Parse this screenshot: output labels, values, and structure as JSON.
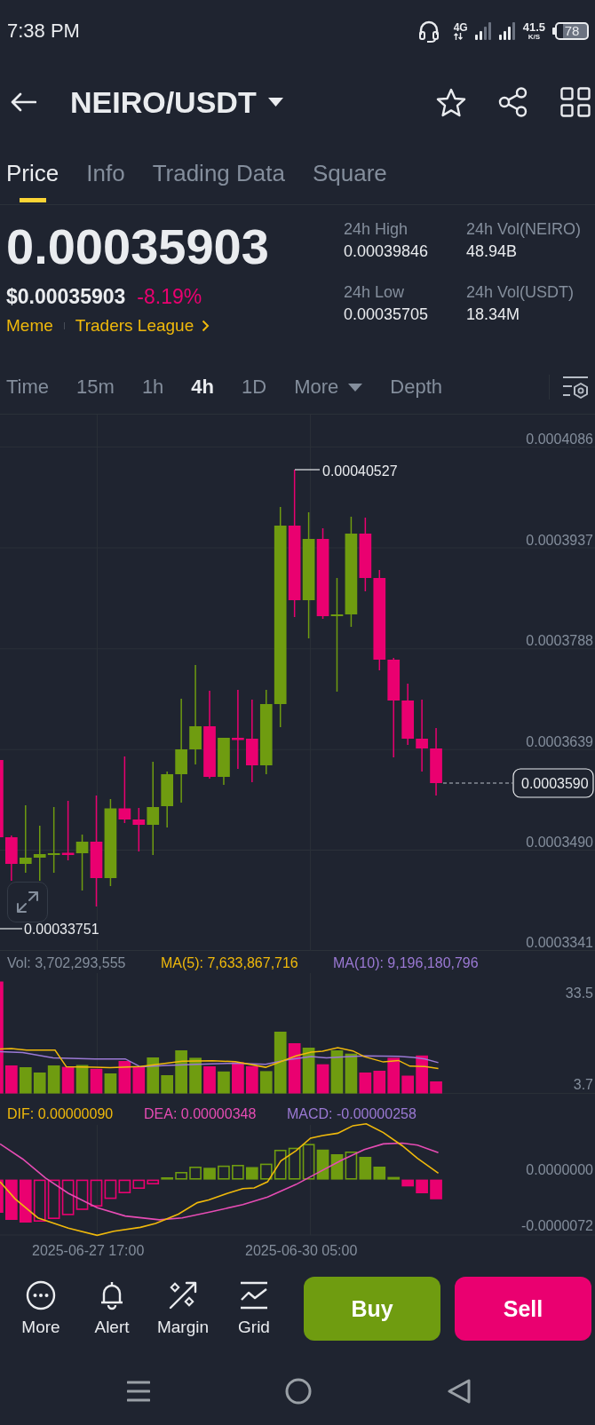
{
  "status_bar": {
    "time": "7:38 PM",
    "network": "4G",
    "speed": "41.5",
    "speed_unit": "K/S",
    "battery": "78"
  },
  "header": {
    "title": "NEIRO/USDT"
  },
  "tabs": [
    {
      "label": "Price",
      "selected": true
    },
    {
      "label": "Info",
      "selected": false
    },
    {
      "label": "Trading Data",
      "selected": false
    },
    {
      "label": "Square",
      "selected": false
    }
  ],
  "ticker": {
    "price": "0.00035903",
    "fiat_price": "$0.00035903",
    "change": "-8.19%",
    "tags": [
      {
        "label": "Meme",
        "kind": "tag"
      },
      {
        "label": "Traders League",
        "kind": "link"
      }
    ]
  },
  "stats": [
    {
      "label": "24h High",
      "value": "0.00039846"
    },
    {
      "label": "24h Vol(NEIRO)",
      "value": "48.94B"
    },
    {
      "label": "24h Low",
      "value": "0.00035705"
    },
    {
      "label": "24h Vol(USDT)",
      "value": "18.34M"
    }
  ],
  "intervals": [
    {
      "label": "Time",
      "kind": "option",
      "selected": false
    },
    {
      "label": "15m",
      "kind": "option",
      "selected": false
    },
    {
      "label": "1h",
      "kind": "option",
      "selected": false
    },
    {
      "label": "4h",
      "kind": "option",
      "selected": true
    },
    {
      "label": "1D",
      "kind": "option",
      "selected": false
    },
    {
      "label": "More",
      "kind": "dropdown",
      "selected": false
    },
    {
      "label": "Depth",
      "kind": "option",
      "selected": false
    }
  ],
  "price_chart": {
    "axis_labels": [
      "0.0004086",
      "0.0003937",
      "0.0003788",
      "0.0003639",
      "0.0003490",
      "0.0003341"
    ],
    "high_label": "0.00040527",
    "low_label": "0.00033751",
    "last_price": "0.0003590"
  },
  "volume": {
    "legend": [
      {
        "text": "Vol: 3,702,293,555",
        "color": "#848e9c"
      },
      {
        "text": "MA(5): 7,633,867,716",
        "color": "#f0b90b"
      },
      {
        "text": "MA(10): 9,196,180,796",
        "color": "#9b79d4"
      }
    ],
    "axis_labels": [
      "33.5",
      "3.7"
    ]
  },
  "macd": {
    "legend": [
      {
        "text": "DIF: 0.00000090",
        "color": "#f0b90b"
      },
      {
        "text": "DEA: 0.00000348",
        "color": "#e64cb4"
      },
      {
        "text": "MACD: -0.00000258",
        "color": "#9b79d4"
      }
    ],
    "axis_labels": [
      "0.0000000",
      "-0.0000072"
    ]
  },
  "time_axis": [
    "2025-06-27 17:00",
    "2025-06-30 05:00"
  ],
  "actions": [
    {
      "label": "More"
    },
    {
      "label": "Alert"
    },
    {
      "label": "Margin"
    },
    {
      "label": "Grid"
    }
  ],
  "trade_buttons": [
    {
      "label": "Buy",
      "kind": "buy"
    },
    {
      "label": "Sell",
      "kind": "sell"
    }
  ]
}
